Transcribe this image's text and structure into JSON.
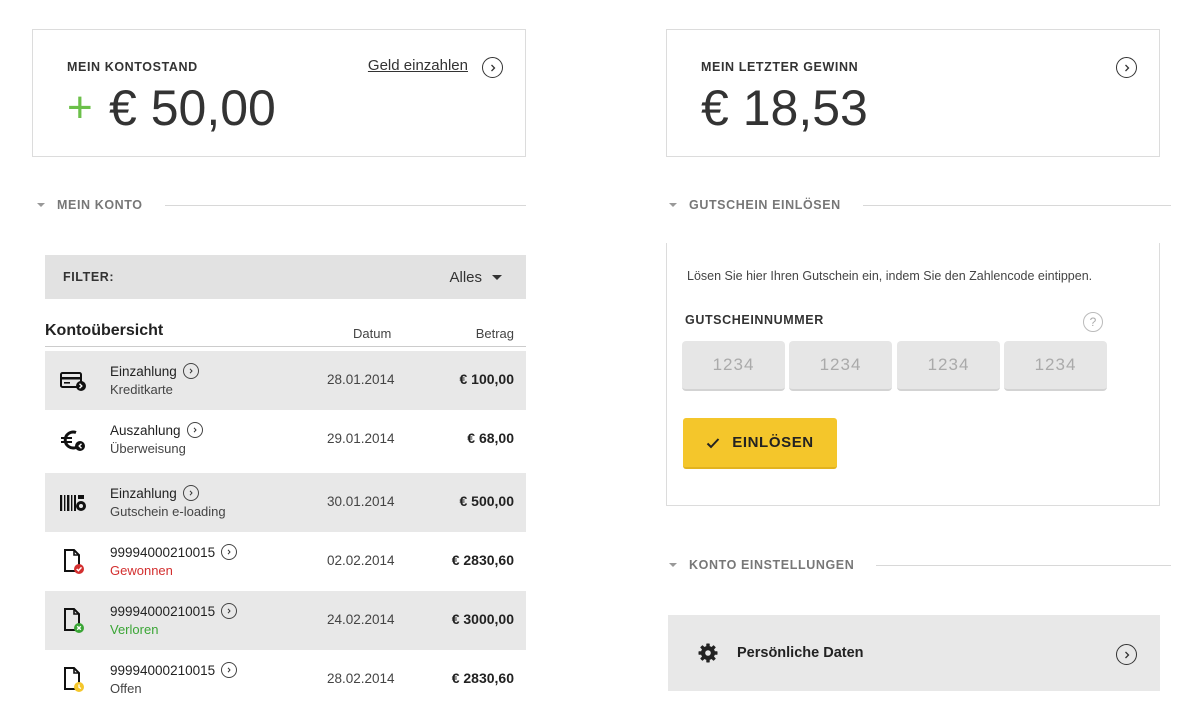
{
  "balance": {
    "label": "MEIN KONTOSTAND",
    "sign": "+",
    "amount": "€ 50,00",
    "deposit_link": "Geld einzahlen"
  },
  "last_win": {
    "label": "MEIN LETZTER GEWINN",
    "amount": "€ 18,53"
  },
  "sections": {
    "account": "MEIN KONTO",
    "voucher": "GUTSCHEIN EINLÖSEN",
    "settings": "KONTO EINSTELLUNGEN"
  },
  "filter": {
    "label": "FILTER:",
    "value": "Alles"
  },
  "table": {
    "title": "Kontoübersicht",
    "col_date": "Datum",
    "col_amount": "Betrag",
    "rows": [
      {
        "icon": "credit-card-icon",
        "title": "Einzahlung",
        "sub": "Kreditkarte",
        "status": "",
        "date": "28.01.2014",
        "amount": "€ 100,00"
      },
      {
        "icon": "euro-payout-icon",
        "title": "Auszahlung",
        "sub": "Überweisung",
        "status": "",
        "date": "29.01.2014",
        "amount": "€ 68,00"
      },
      {
        "icon": "barcode-icon",
        "title": "Einzahlung",
        "sub": "Gutschein e-loading",
        "status": "",
        "date": "30.01.2014",
        "amount": "€ 500,00"
      },
      {
        "icon": "ticket-won-icon",
        "title": "99994000210015",
        "sub": "Gewonnen",
        "status": "won",
        "date": "02.02.2014",
        "amount": "€ 2830,60"
      },
      {
        "icon": "ticket-lost-icon",
        "title": "99994000210015",
        "sub": "Verloren",
        "status": "lost",
        "date": "24.02.2014",
        "amount": "€ 3000,00"
      },
      {
        "icon": "ticket-open-icon",
        "title": "99994000210015",
        "sub": "Offen",
        "status": "open",
        "date": "28.02.2014",
        "amount": "€ 2830,60"
      }
    ]
  },
  "voucher": {
    "description": "Lösen Sie hier Ihren Gutschein ein, indem Sie den Zahlencode eintippen.",
    "field_label": "GUTSCHEINNUMMER",
    "help": "?",
    "placeholders": [
      "1234",
      "1234",
      "1234",
      "1234"
    ],
    "button": "EINLÖSEN"
  },
  "settings": {
    "personal_data": "Persönliche Daten"
  },
  "colors": {
    "accent_yellow": "#f4c62b",
    "plus_green": "#6cc04a",
    "won_red": "#d32f2f",
    "lost_green": "#3aa535",
    "open_yellow": "#f4c62b"
  }
}
